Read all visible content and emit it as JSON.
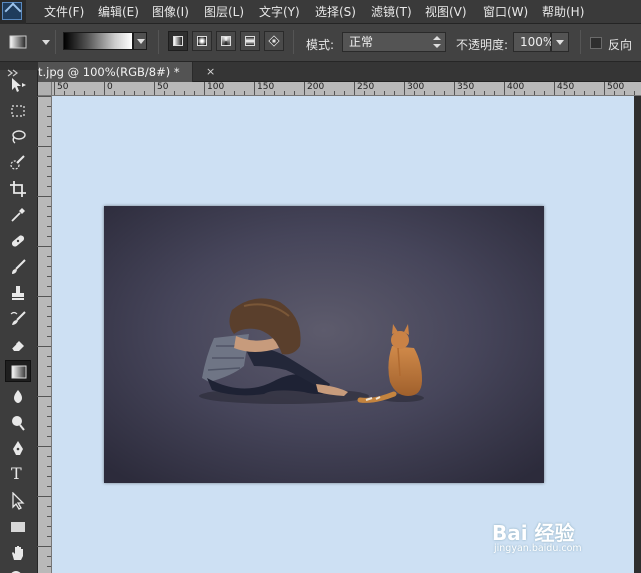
{
  "menubar": {
    "items": [
      "文件(F)",
      "编辑(E)",
      "图像(I)",
      "图层(L)",
      "文字(Y)",
      "选择(S)",
      "滤镜(T)",
      "视图(V)",
      "窗口(W)",
      "帮助(H)"
    ]
  },
  "options": {
    "gradient_types": [
      "linear",
      "radial",
      "angle",
      "reflected",
      "diamond"
    ],
    "active_gradient_type": "linear",
    "mode_label": "模式:",
    "mode_value": "正常",
    "opacity_label": "不透明度:",
    "opacity_value": "100%",
    "reverse_label": "反向",
    "reverse_checked": false
  },
  "document": {
    "tab_title": "t.jpg @ 100%(RGB/8#) *",
    "close_symbol": "×"
  },
  "ruler": {
    "h_labels": [
      "50",
      "0",
      "50",
      "100",
      "150",
      "200",
      "250",
      "300",
      "350",
      "400",
      "450",
      "500"
    ]
  },
  "tools": {
    "items": [
      "move-tool",
      "marquee-tool",
      "lasso-tool",
      "quick-selection-tool",
      "crop-tool",
      "eyedropper-tool",
      "healing-brush-tool",
      "brush-tool",
      "clone-stamp-tool",
      "history-brush-tool",
      "eraser-tool",
      "gradient-tool",
      "blur-tool",
      "dodge-tool",
      "pen-tool",
      "type-tool",
      "path-selection-tool",
      "rectangle-tool",
      "hand-tool",
      "zoom-tool"
    ],
    "active": "gradient-tool",
    "type_glyph": "T"
  },
  "canvas": {
    "background_color": "#cde0f3",
    "photo_subject": "girl-and-cat-on-road-photo"
  },
  "watermark": {
    "brand": "Bai 经验",
    "url": "jingyan.baidu.com"
  }
}
